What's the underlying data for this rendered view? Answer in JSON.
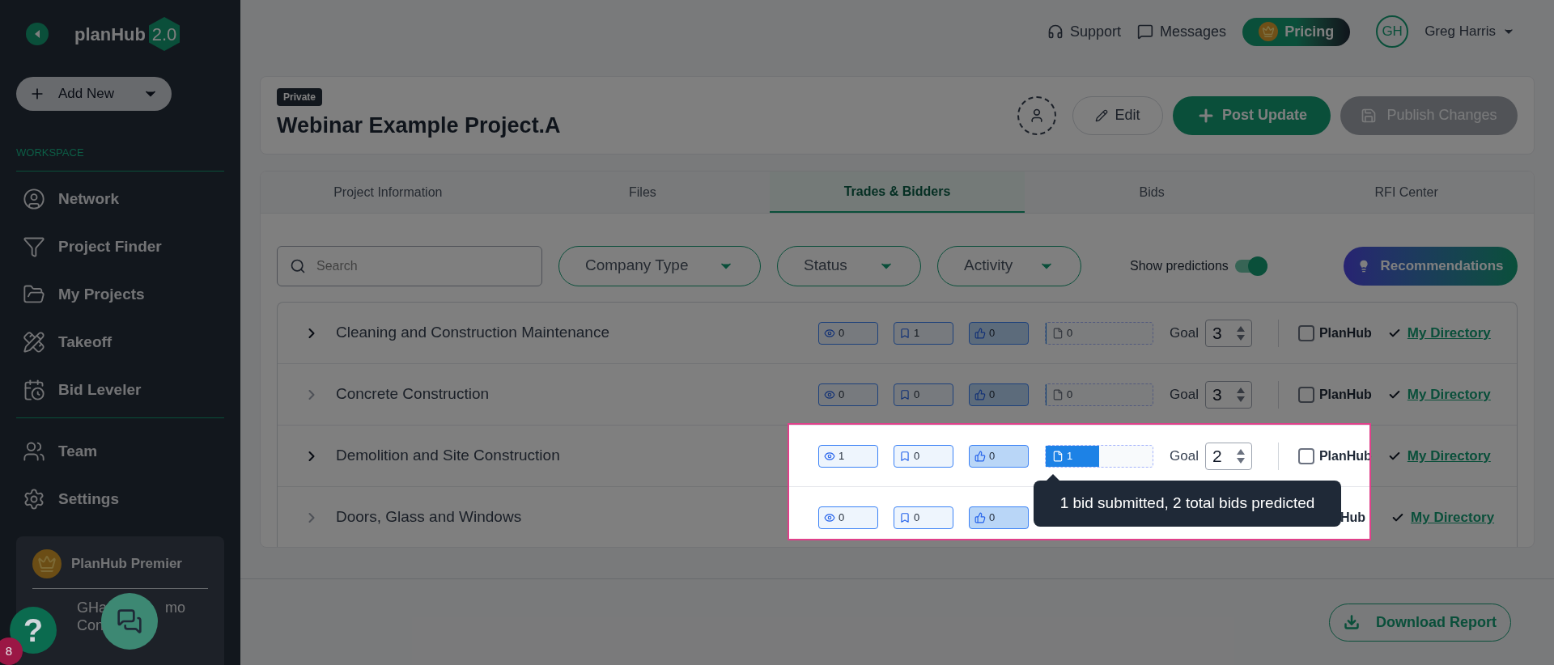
{
  "sidebar": {
    "logo": "planHub",
    "logo_badge": "2.0",
    "add_button": "Add New",
    "section_label": "WORKSPACE",
    "items": [
      {
        "label": "Network"
      },
      {
        "label": "Project Finder"
      },
      {
        "label": "My Projects"
      },
      {
        "label": "Takeoff"
      },
      {
        "label": "Bid Leveler"
      }
    ],
    "bottom_items": [
      {
        "label": "Team"
      },
      {
        "label": "Settings"
      }
    ],
    "plan_card": {
      "title": "PlanHub Premier",
      "account_line_1": "GHa",
      "account_line_1_end": "mo",
      "account_line_2": "Con"
    },
    "help": {
      "label": "?",
      "badge": "8"
    }
  },
  "topbar": {
    "support": "Support",
    "messages": "Messages",
    "pricing": "Pricing",
    "user_initials": "GH",
    "user_name": "Greg Harris"
  },
  "project": {
    "badge": "Private",
    "title": "Webinar Example Project.A",
    "edit": "Edit",
    "post_update": "Post Update",
    "publish": "Publish Changes",
    "publish_disabled": true
  },
  "tabs": [
    {
      "label": "Project Information",
      "selected": false
    },
    {
      "label": "Files",
      "selected": false
    },
    {
      "label": "Trades & Bidders",
      "selected": true
    },
    {
      "label": "Bids",
      "selected": false
    },
    {
      "label": "RFI Center",
      "selected": false
    }
  ],
  "filters": {
    "search_placeholder": "Search",
    "dropdowns": [
      "Company Type",
      "Status",
      "Activity"
    ],
    "predictions_label": "Show predictions",
    "predictions_on": true,
    "recommendations": "Recommendations"
  },
  "trades": [
    {
      "name": "Cleaning and Construction Maintenance",
      "active": true,
      "views": "0",
      "saves": "1",
      "likes": "0",
      "bids": {
        "count": "0",
        "level": 0
      },
      "goal_label": "Goal",
      "goal": "3",
      "planhub": {
        "label": "PlanHub",
        "checked": false
      },
      "directory": "My Directory"
    },
    {
      "name": "Concrete Construction",
      "active": false,
      "views": "0",
      "saves": "0",
      "likes": "0",
      "bids": {
        "count": "0",
        "level": 0
      },
      "goal_label": "Goal",
      "goal": "3",
      "planhub": {
        "label": "PlanHub",
        "checked": false
      },
      "directory": "My Directory"
    },
    {
      "name": "Demolition and Site Construction",
      "active": true,
      "views": "1",
      "saves": "0",
      "likes": "0",
      "bids": {
        "count": "1",
        "level": 0.5
      },
      "goal_label": "Goal",
      "goal": "2",
      "planhub": {
        "label": "PlanHub",
        "checked": false
      },
      "directory": "My Directory"
    },
    {
      "name": "Doors, Glass and Windows",
      "active": false,
      "views": "0",
      "saves": "0",
      "likes": "0",
      "planhub_partial": "Hub",
      "directory": "My Directory"
    }
  ],
  "tooltip": "1 bid submitted, 2 total bids predicted",
  "download": "Download Report"
}
